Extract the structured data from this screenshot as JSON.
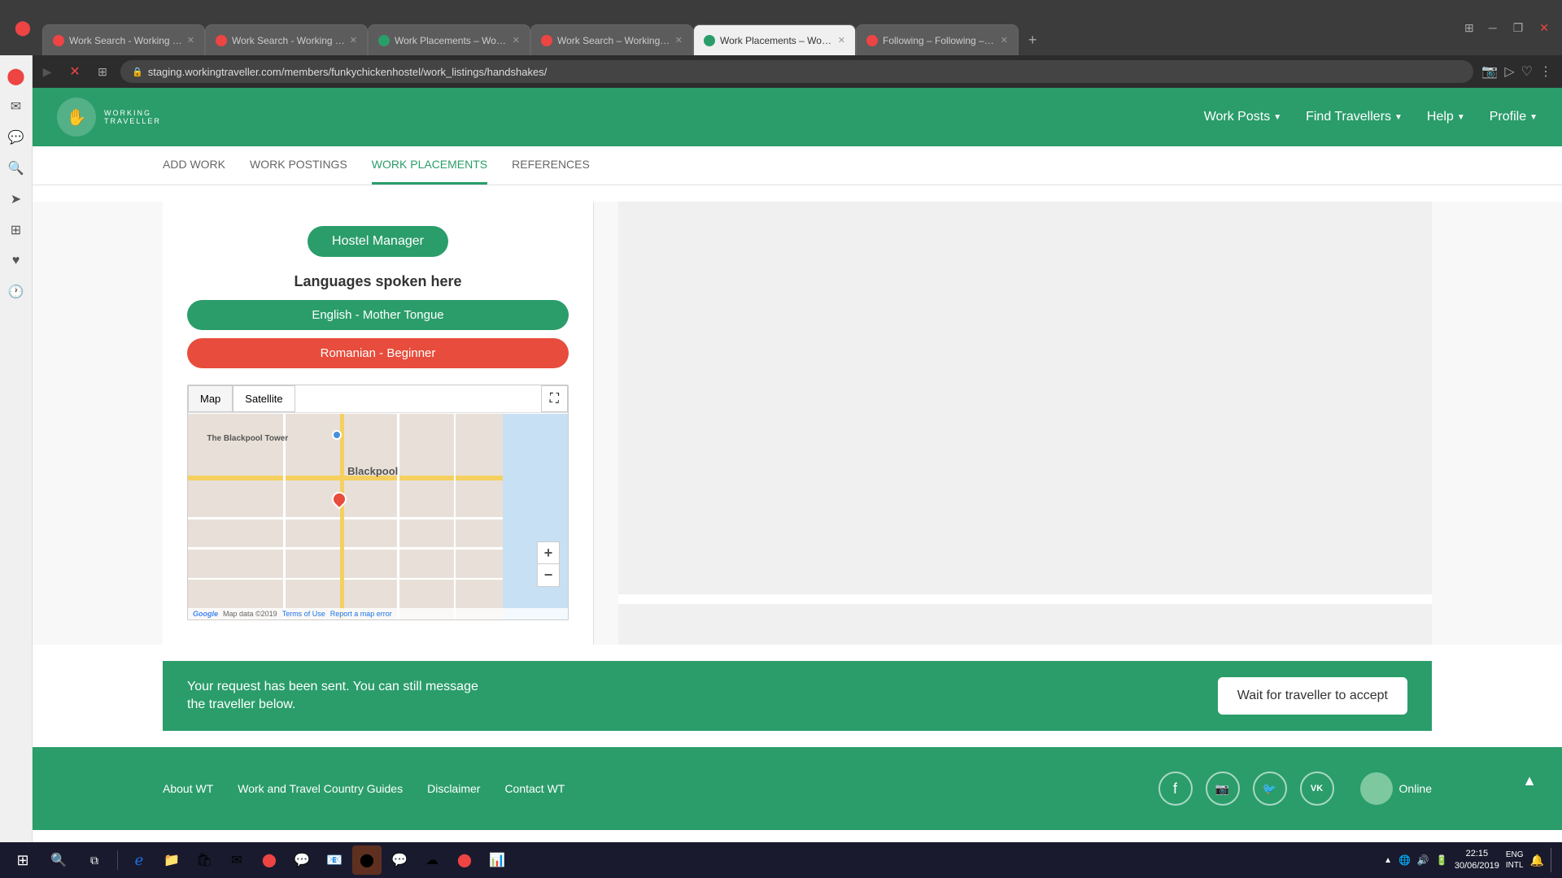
{
  "browser": {
    "tabs": [
      {
        "id": "tab1",
        "label": "Work Search - Working Tra",
        "icon": "opera",
        "active": false,
        "closable": true
      },
      {
        "id": "tab2",
        "label": "Work Search - Working Tra",
        "icon": "opera",
        "active": false,
        "closable": true
      },
      {
        "id": "tab3",
        "label": "Work Placements – Work P",
        "icon": "wt",
        "active": false,
        "closable": true
      },
      {
        "id": "tab4",
        "label": "Work Search – Working Tra",
        "icon": "opera",
        "active": false,
        "closable": true
      },
      {
        "id": "tab5",
        "label": "Work Placements – Work P",
        "icon": "wt",
        "active": true,
        "closable": true
      },
      {
        "id": "tab6",
        "label": "Following – Following – Jo",
        "icon": "opera",
        "active": false,
        "closable": true
      }
    ],
    "address": "staging.workingtraveller.com/members/funkychickenhostel/work_listings/handshakes/",
    "new_tab_label": "+"
  },
  "nav": {
    "logo_text_line1": "WORKING",
    "logo_text_line2": "TRAVELLER",
    "work_posts_label": "Work Posts",
    "find_travellers_label": "Find Travellers",
    "help_label": "Help",
    "profile_label": "Profile"
  },
  "sub_nav": {
    "items": [
      {
        "id": "add-work",
        "label": "ADD WORK",
        "active": false
      },
      {
        "id": "work-postings",
        "label": "WORK POSTINGS",
        "active": false
      },
      {
        "id": "work-placements",
        "label": "WORK PLACEMENTS",
        "active": true
      },
      {
        "id": "references",
        "label": "REFERENCES",
        "active": false
      }
    ]
  },
  "left_panel": {
    "role_btn": "Hostel Manager",
    "languages_title": "Languages spoken here",
    "languages": [
      {
        "id": "english",
        "label": "English - Mother Tongue",
        "style": "english"
      },
      {
        "id": "romanian",
        "label": "Romanian - Beginner",
        "style": "romanian"
      }
    ],
    "map": {
      "btn_map": "Map",
      "btn_satellite": "Satellite",
      "location_label": "Blackpool",
      "blackpool_tower_label": "The Blackpool Tower",
      "footer_data": "Map data ©2019",
      "terms_label": "Terms of Use",
      "report_label": "Report a map error",
      "google_label": "Google"
    }
  },
  "notification": {
    "message": "Your request has been sent. You can still message\nthe traveller below.",
    "button_label": "Wait for traveller to accept"
  },
  "footer": {
    "links": [
      {
        "id": "about",
        "label": "About WT"
      },
      {
        "id": "guides",
        "label": "Work and Travel Country Guides"
      },
      {
        "id": "disclaimer",
        "label": "Disclaimer"
      },
      {
        "id": "contact",
        "label": "Contact WT"
      }
    ],
    "social": [
      {
        "id": "facebook",
        "icon": "f"
      },
      {
        "id": "instagram",
        "icon": "📷"
      },
      {
        "id": "twitter",
        "icon": "🐦"
      },
      {
        "id": "vk",
        "icon": "VK"
      }
    ],
    "online_label": "Online"
  },
  "sidebar_icons": [
    {
      "id": "news-feed",
      "icon": "📰",
      "label": "News feed"
    },
    {
      "id": "messages",
      "icon": "✉",
      "label": "Messages"
    },
    {
      "id": "notifications-bell",
      "icon": "🔔",
      "label": "Notifications"
    },
    {
      "id": "discover",
      "icon": "🔍",
      "label": "Discover"
    },
    {
      "id": "create",
      "icon": "✏",
      "label": "Create"
    },
    {
      "id": "people",
      "icon": "👥",
      "label": "People"
    },
    {
      "id": "heart",
      "icon": "♥",
      "label": "Saved"
    },
    {
      "id": "history",
      "icon": "🕐",
      "label": "History"
    }
  ],
  "taskbar": {
    "time": "22:15",
    "date": "30/06/2019",
    "language": "ENG\nINTL",
    "start_label": "⊞",
    "icons": [
      "🔍",
      "📁",
      "📂",
      "💼",
      "📧",
      "🌐",
      "💬",
      "📦",
      "🔴",
      "🎵"
    ]
  }
}
